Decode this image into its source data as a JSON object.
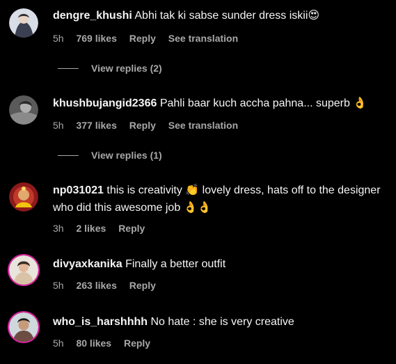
{
  "comments": [
    {
      "username": "dengre_khushi",
      "text": "Abhi tak ki sabse sunder dress iskii😍",
      "time": "5h",
      "likes": "769 likes",
      "reply": "Reply",
      "translate": "See translation",
      "view_replies": "View replies (2)"
    },
    {
      "username": "khushbujangid2366",
      "text": "Pahli baar kuch accha pahna... superb 👌",
      "time": "5h",
      "likes": "377 likes",
      "reply": "Reply",
      "translate": "See translation",
      "view_replies": "View replies (1)"
    },
    {
      "username": "np031021",
      "text": "this is creativity 👏 lovely dress, hats off to the designer who did this awesome job 👌👌",
      "time": "3h",
      "likes": "2 likes",
      "reply": "Reply"
    },
    {
      "username": "divyaxkanika",
      "text": "Finally a better outfit",
      "time": "5h",
      "likes": "263 likes",
      "reply": "Reply"
    },
    {
      "username": "who_is_harshhhh",
      "text": "No hate : she is very creative",
      "time": "5h",
      "likes": "80 likes",
      "reply": "Reply"
    }
  ],
  "colors": {
    "background": "#000000",
    "primary_text": "#f5f5f5",
    "secondary_text": "#a8a8a8"
  }
}
